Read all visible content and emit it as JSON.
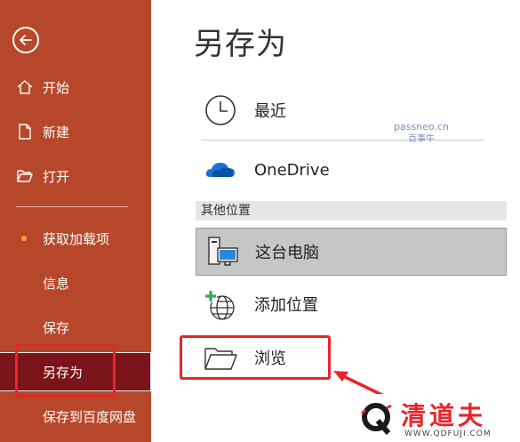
{
  "sidebar": {
    "back_icon": "back-arrow-icon",
    "items": [
      {
        "label": "开始",
        "icon": "home-icon"
      },
      {
        "label": "新建",
        "icon": "new-document-icon"
      },
      {
        "label": "打开",
        "icon": "open-folder-icon"
      },
      {
        "label": "获取加载项",
        "badge": "dot"
      },
      {
        "label": "信息"
      },
      {
        "label": "保存"
      },
      {
        "label": "另存为",
        "selected": true
      },
      {
        "label": "保存到百度网盘"
      }
    ],
    "colors": {
      "background": "#b7472a",
      "selected": "#7b1418",
      "badge_dot": "#f7a24a"
    }
  },
  "main": {
    "title": "另存为",
    "locations": {
      "recent": {
        "label": "最近",
        "icon": "clock-icon"
      },
      "onedrive": {
        "label": "OneDrive",
        "icon": "cloud-icon"
      }
    },
    "other_section": {
      "header": "其他位置",
      "items": [
        {
          "label": "这台电脑",
          "icon": "computer-icon",
          "selected": true
        },
        {
          "label": "添加位置",
          "icon": "add-globe-icon"
        },
        {
          "label": "浏览",
          "icon": "folder-icon"
        }
      ]
    }
  },
  "watermark": {
    "line1": "passneo.cn",
    "line2": "百事牛"
  },
  "brand": {
    "name": "清道夫",
    "url": "WWW.QDFUJI.COM"
  },
  "annotation_color": "#e8242b"
}
